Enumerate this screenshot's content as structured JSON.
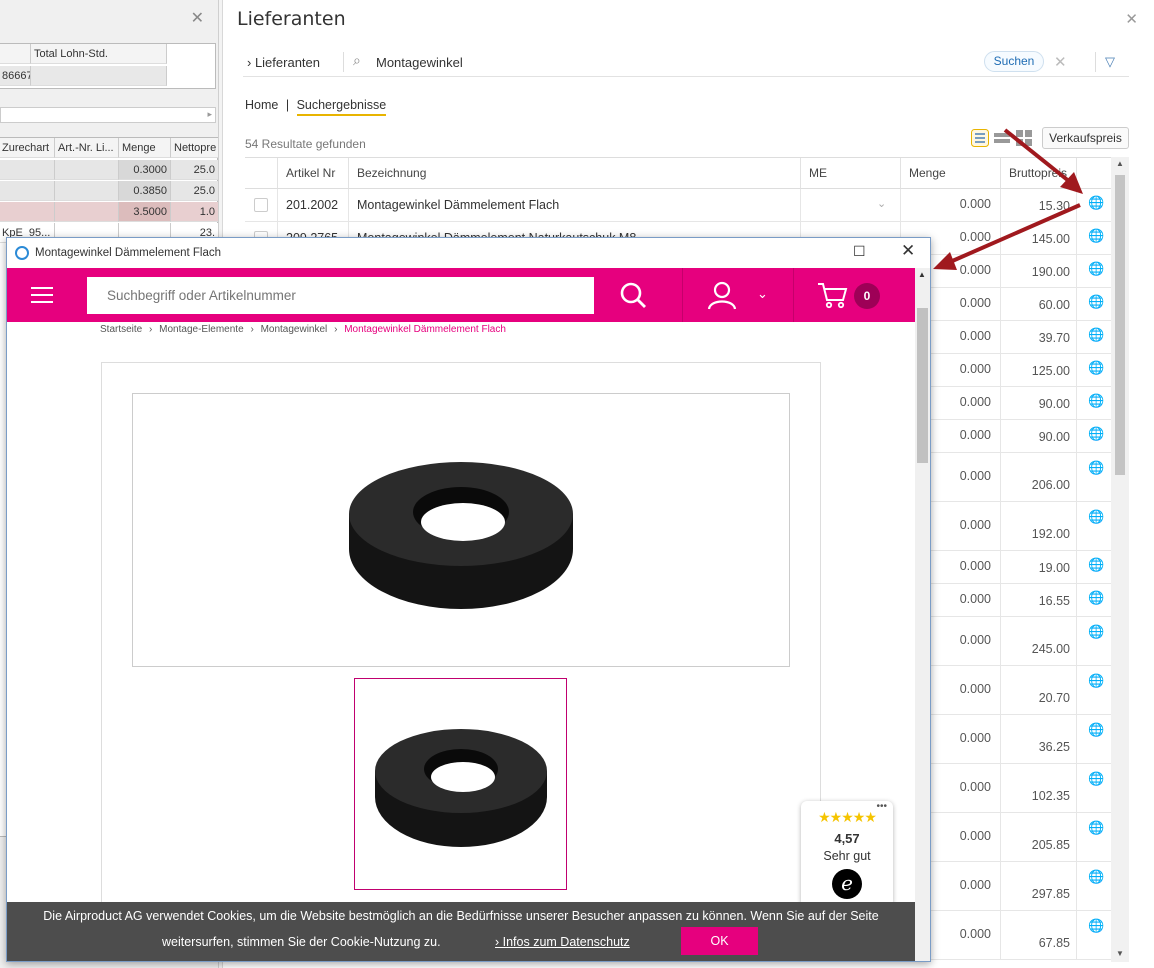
{
  "left_panel": {
    "table1": {
      "headers": [
        "",
        "Total Lohn-Std."
      ],
      "row": [
        "86667",
        ""
      ]
    },
    "table2": {
      "headers": [
        "Zurechart",
        "Art.-Nr. Li...",
        "Menge",
        "Nettopre"
      ],
      "rows": [
        [
          "",
          "",
          "0.3000",
          "25.0"
        ],
        [
          "",
          "",
          "0.3850",
          "25.0"
        ],
        [
          "",
          "",
          "3.5000",
          "1.0"
        ],
        [
          "KpE_95...",
          "",
          "",
          "23."
        ]
      ]
    }
  },
  "main": {
    "title": "Lieferanten",
    "search": {
      "scope": "› Lieferanten",
      "value": "Montagewinkel",
      "button": "Suchen"
    },
    "breadcrumb": {
      "home": "Home",
      "sep": "|",
      "current": "Suchergebnisse"
    },
    "results_text": "54 Resultate gefunden",
    "price_button": "Verkaufspreis",
    "grid": {
      "headers": {
        "artikel": "Artikel Nr",
        "bez": "Bezeichnung",
        "me": "ME",
        "menge": "Menge",
        "preis": "Bruttopreis"
      },
      "rows": [
        {
          "art": "201.2002",
          "bez": "Montagewinkel Dämmelement Flach",
          "menge": "0.000",
          "preis": "15.30"
        },
        {
          "art": "209.2765",
          "bez": "Montagewinkel Dämmelement Naturkautschuk M8",
          "menge": "0.000",
          "preis": "145.00"
        },
        {
          "art": "",
          "bez": "",
          "menge": "0.000",
          "preis": "190.00"
        },
        {
          "art": "",
          "bez": "",
          "menge": "0.000",
          "preis": "60.00"
        },
        {
          "art": "",
          "bez": "",
          "menge": "0.000",
          "preis": "39.70"
        },
        {
          "art": "",
          "bez": "",
          "menge": "0.000",
          "preis": "125.00"
        },
        {
          "art": "",
          "bez": "",
          "menge": "0.000",
          "preis": "90.00"
        },
        {
          "art": "",
          "bez": "",
          "menge": "0.000",
          "preis": "90.00"
        },
        {
          "art": "",
          "bez": "",
          "menge": "0.000",
          "preis": "206.00"
        },
        {
          "art": "",
          "bez": "",
          "menge": "0.000",
          "preis": "192.00"
        },
        {
          "art": "",
          "bez": "",
          "menge": "0.000",
          "preis": "19.00"
        },
        {
          "art": "",
          "bez": "",
          "menge": "0.000",
          "preis": "16.55"
        },
        {
          "art": "",
          "bez": "",
          "menge": "0.000",
          "preis": "245.00"
        },
        {
          "art": "",
          "bez": "",
          "menge": "0.000",
          "preis": "20.70"
        },
        {
          "art": "",
          "bez": "",
          "menge": "0.000",
          "preis": "36.25"
        },
        {
          "art": "",
          "bez": "",
          "menge": "0.000",
          "preis": "102.35"
        },
        {
          "art": "",
          "bez": "",
          "menge": "0.000",
          "preis": "205.85"
        },
        {
          "art": "",
          "bez": "",
          "menge": "0.000",
          "preis": "297.85"
        },
        {
          "art": "",
          "bez": "",
          "menge": "0.000",
          "preis": "67.85"
        }
      ]
    }
  },
  "popup": {
    "title": "Montagewinkel Dämmelement Flach",
    "search_placeholder": "Suchbegriff oder Artikelnummer",
    "cart_count": "0",
    "breadcrumb": [
      "Startseite",
      "Montage-Elemente",
      "Montagewinkel",
      "Montagewinkel Dämmelement Flach"
    ],
    "badge": {
      "stars": "★★★★★",
      "rating": "4,57",
      "label": "Sehr gut",
      "logo": "e"
    },
    "cookie": {
      "line1": "Die Airproduct AG verwendet Cookies, um die Website bestmöglich an die Bedürfnisse unserer Besucher anpassen zu können. Wenn Sie auf der Seite",
      "line2": "weitersurfen, stimmen Sie der Cookie-Nutzung zu.",
      "link": "› Infos zum Datenschutz",
      "ok": "OK"
    }
  },
  "colors": {
    "brand": "#e6007e",
    "arrow": "#a0191e"
  }
}
